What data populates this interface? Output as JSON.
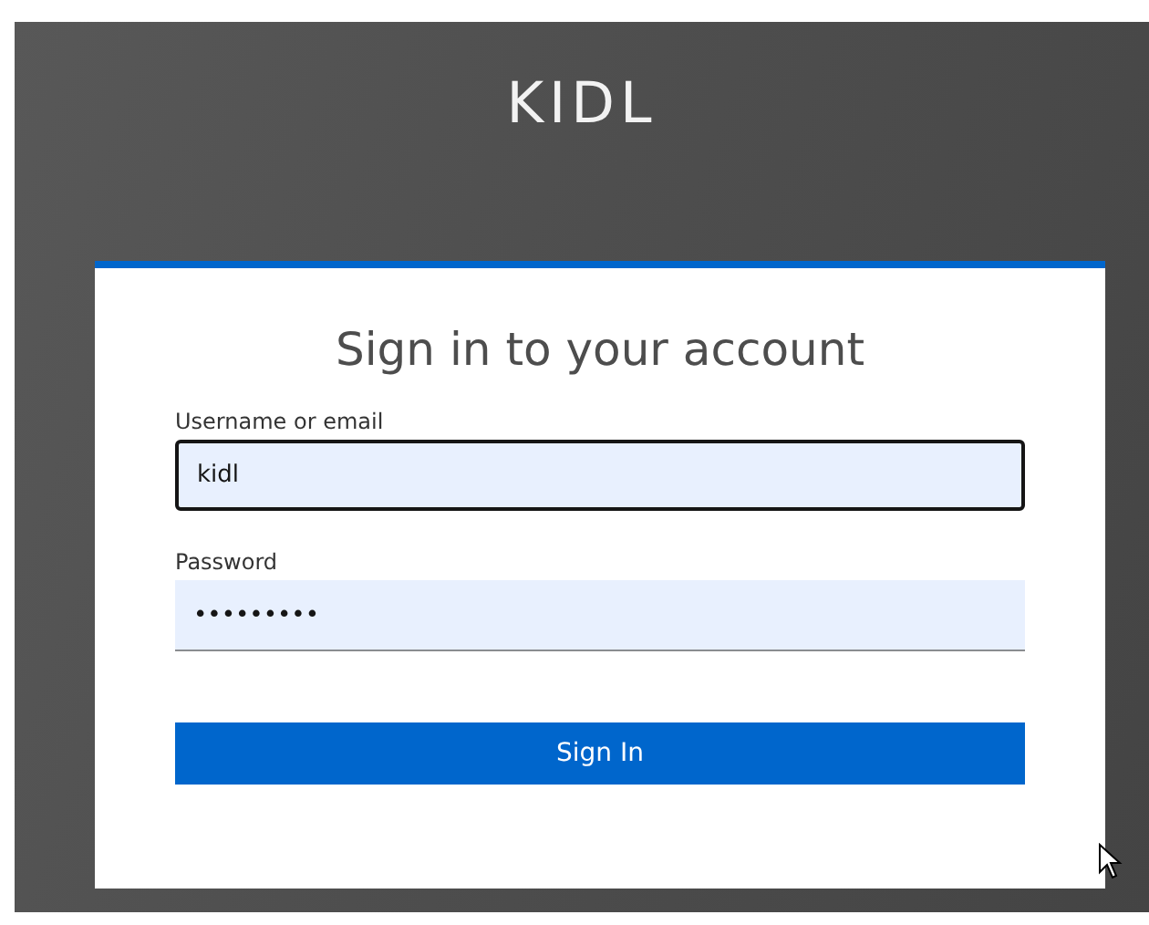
{
  "brand": "KIDL",
  "card": {
    "title": "Sign in to your account"
  },
  "fields": [
    {
      "label": "Username or email",
      "value": "kidl",
      "focused": true
    },
    {
      "label": "Password",
      "value": "•••••••••",
      "focused": false
    }
  ],
  "button": "Sign In"
}
